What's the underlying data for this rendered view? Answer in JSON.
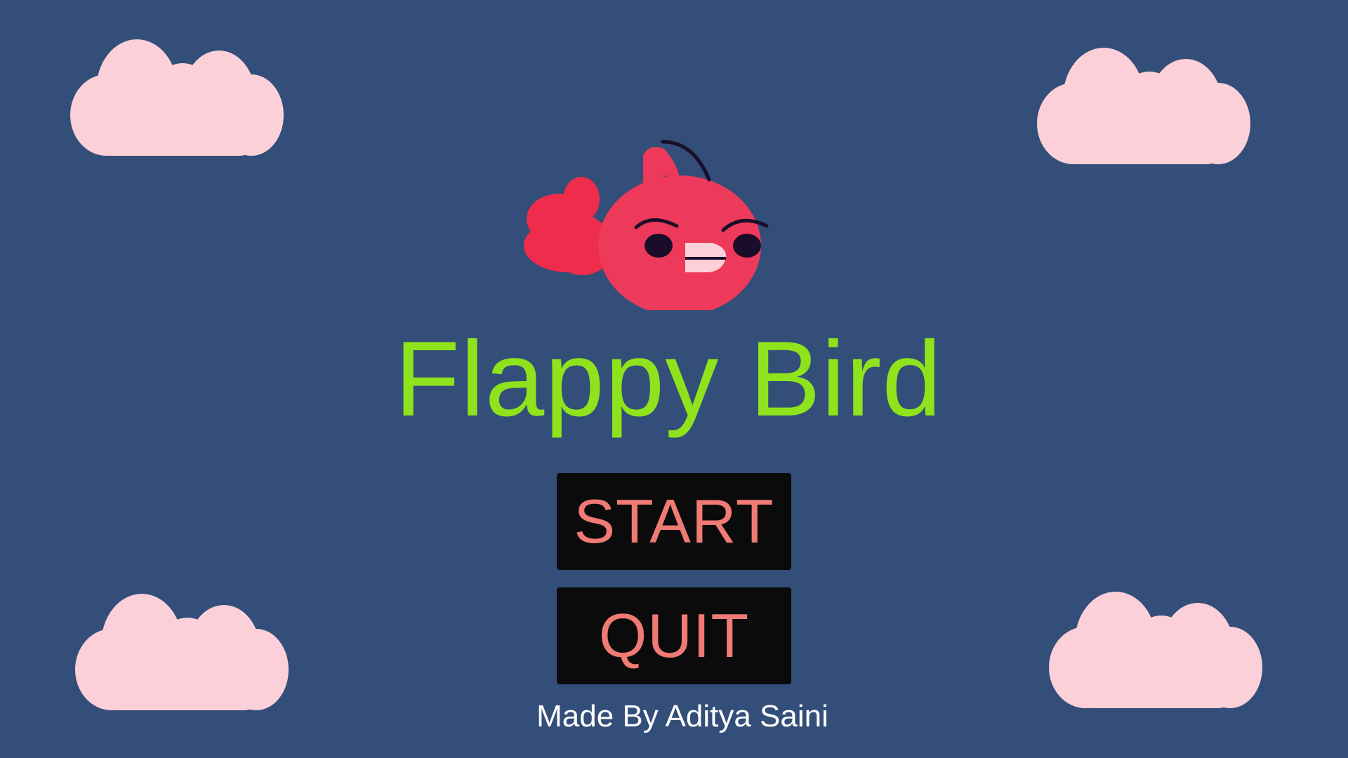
{
  "game": {
    "title": "Flappy Bird",
    "credit": "Made By Aditya Saini"
  },
  "menu": {
    "start_label": "START",
    "quit_label": "QUIT"
  },
  "colors": {
    "background": "#334e78",
    "title": "#8fe31c",
    "button_bg": "#0b0b0b",
    "button_text": "#f07a74",
    "cloud": "#fbd1da",
    "bird": "#ee3a5a"
  }
}
